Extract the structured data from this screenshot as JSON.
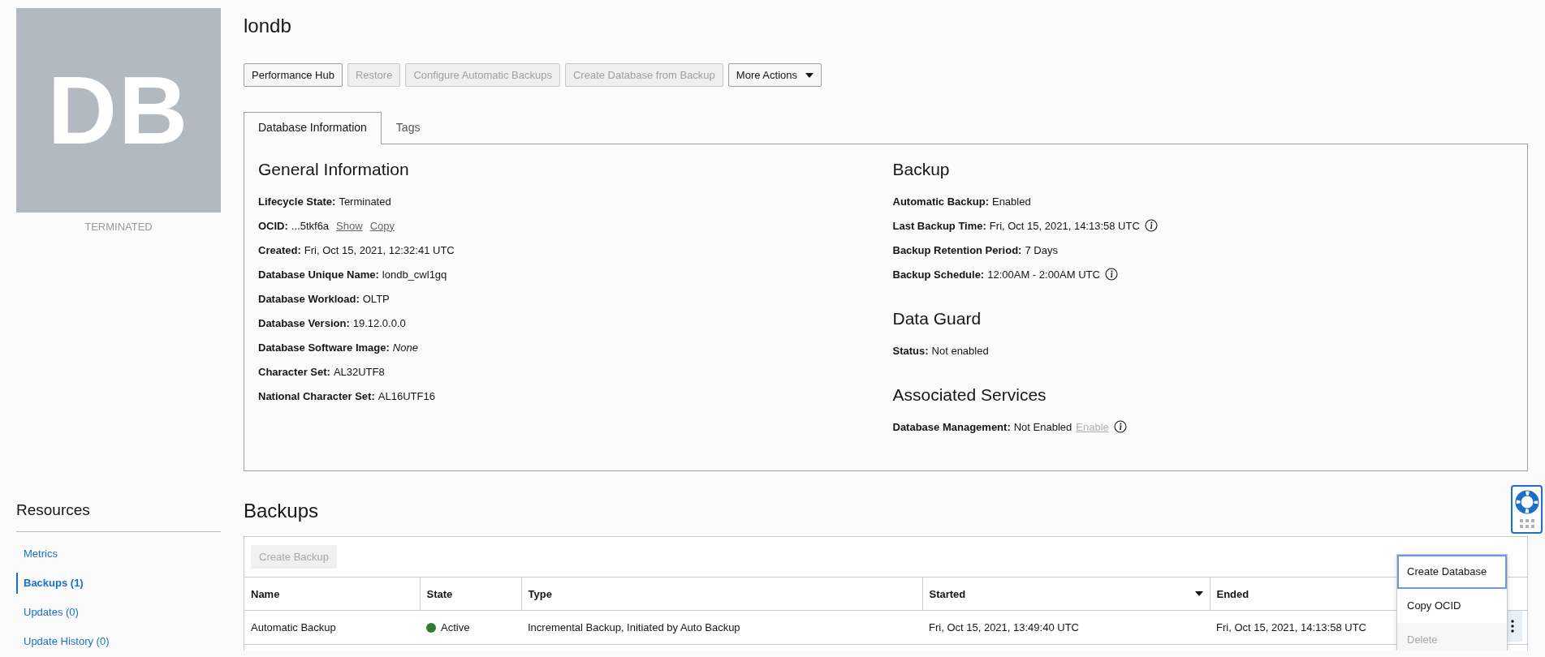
{
  "tile": {
    "initials": "DB",
    "status": "TERMINATED"
  },
  "page_title": "londb",
  "actions": [
    {
      "label": "Performance Hub",
      "disabled": false,
      "kind": "button"
    },
    {
      "label": "Restore",
      "disabled": true,
      "kind": "button"
    },
    {
      "label": "Configure Automatic Backups",
      "disabled": true,
      "kind": "button"
    },
    {
      "label": "Create Database from Backup",
      "disabled": true,
      "kind": "button"
    },
    {
      "label": "More Actions",
      "disabled": false,
      "kind": "dropdown"
    }
  ],
  "tabs": [
    {
      "label": "Database Information",
      "selected": true
    },
    {
      "label": "Tags",
      "selected": false
    }
  ],
  "info_columns": [
    {
      "sections": [
        {
          "heading": "General Information",
          "fields": [
            {
              "label": "Lifecycle State:",
              "value": "Terminated",
              "italic": false,
              "info": false
            },
            {
              "label": "OCID:",
              "value": "...5tkf6a",
              "italic": false,
              "info": false,
              "links": [
                {
                  "label": "Show",
                  "disabled": false
                },
                {
                  "label": "Copy",
                  "disabled": false
                }
              ]
            },
            {
              "label": "Created:",
              "value": "Fri, Oct 15, 2021, 12:32:41 UTC",
              "italic": false,
              "info": false
            },
            {
              "label": "Database Unique Name:",
              "value": "londb_cwl1gq",
              "italic": false,
              "info": false
            },
            {
              "label": "Database Workload:",
              "value": "OLTP",
              "italic": false,
              "info": false
            },
            {
              "label": "Database Version:",
              "value": "19.12.0.0.0",
              "italic": false,
              "info": false
            },
            {
              "label": "Database Software Image:",
              "value": "None",
              "italic": true,
              "info": false
            },
            {
              "label": "Character Set:",
              "value": "AL32UTF8",
              "italic": false,
              "info": false
            },
            {
              "label": "National Character Set:",
              "value": "AL16UTF16",
              "italic": false,
              "info": false
            }
          ]
        }
      ]
    },
    {
      "sections": [
        {
          "heading": "Backup",
          "fields": [
            {
              "label": "Automatic Backup:",
              "value": "Enabled",
              "italic": false,
              "info": false
            },
            {
              "label": "Last Backup Time:",
              "value": "Fri, Oct 15, 2021, 14:13:58 UTC",
              "italic": false,
              "info": true
            },
            {
              "label": "Backup Retention Period:",
              "value": "7 Days",
              "italic": false,
              "info": false
            },
            {
              "label": "Backup Schedule:",
              "value": "12:00AM - 2:00AM UTC",
              "italic": false,
              "info": true
            }
          ]
        },
        {
          "heading": "Data Guard",
          "fields": [
            {
              "label": "Status:",
              "value": "Not enabled",
              "italic": false,
              "info": false
            }
          ]
        },
        {
          "heading": "Associated Services",
          "fields": [
            {
              "label": "Database Management:",
              "value": "Not Enabled",
              "italic": false,
              "info": true,
              "links": [
                {
                  "label": "Enable",
                  "disabled": true
                }
              ]
            }
          ]
        }
      ]
    }
  ],
  "resources": {
    "title": "Resources",
    "items": [
      {
        "label": "Metrics",
        "selected": false
      },
      {
        "label": "Backups (1)",
        "selected": true
      },
      {
        "label": "Updates (0)",
        "selected": false
      },
      {
        "label": "Update History (0)",
        "selected": false
      }
    ]
  },
  "backups": {
    "title": "Backups",
    "create_button": {
      "label": "Create Backup",
      "disabled": true
    },
    "columns": [
      {
        "label": "Name",
        "sorted": false
      },
      {
        "label": "State",
        "sorted": false
      },
      {
        "label": "Type",
        "sorted": false
      },
      {
        "label": "Started",
        "sorted": true
      },
      {
        "label": "Ended",
        "sorted": false
      }
    ],
    "rows": [
      {
        "name": "Automatic Backup",
        "state": "Active",
        "color": "#2e7d32",
        "type": "Incremental Backup, Initiated by Auto Backup",
        "started": "Fri, Oct 15, 2021, 13:49:40 UTC",
        "ended": "Fri, Oct 15, 2021, 14:13:58 UTC",
        "menu_open": true
      }
    ],
    "row_menu": [
      {
        "label": "Create Database",
        "focused": true,
        "disabled": false
      },
      {
        "label": "Copy OCID",
        "focused": false,
        "disabled": false
      },
      {
        "label": "Delete",
        "focused": false,
        "disabled": true
      }
    ]
  }
}
